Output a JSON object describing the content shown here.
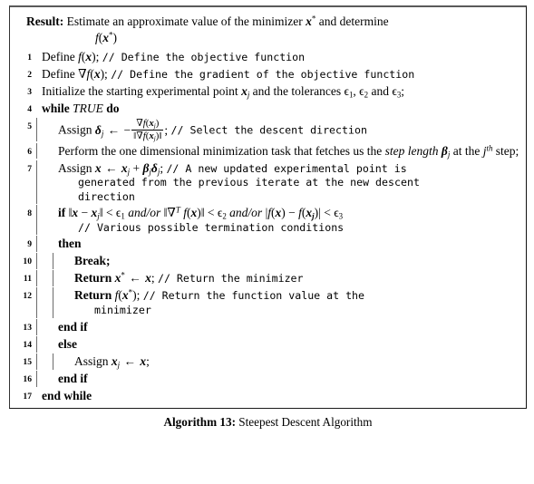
{
  "figure": {
    "caption_label": "Algorithm 13:",
    "caption_title": "Steepest Descent Algorithm"
  },
  "result": {
    "label": "Result:",
    "text": "Estimate an approximate value of the minimizer",
    "var_x_star": "x*",
    "text_tail": "and determine",
    "line2": "f(x*)"
  },
  "lines": [
    {
      "no": "1",
      "code": "Define f(x);",
      "comment": "// Define the objective function"
    },
    {
      "no": "2",
      "code": "Define ∇f(x);",
      "comment": "// Define the gradient of the objective function"
    },
    {
      "no": "3",
      "code": "Initialize the starting experimental point x_j and the tolerances ε1, ε2 and ε3;",
      "comment": ""
    },
    {
      "no": "4",
      "keyword": "while",
      "cond": "TRUE",
      "keyword2": "do",
      "code": "while TRUE do",
      "comment": ""
    },
    {
      "no": "5",
      "code": "Assign δ_j ← − ∇f(x_j) / ‖∇f(x_j)‖;",
      "comment": "// Select the descent direction"
    },
    {
      "no": "6",
      "code": "Perform the one dimensional minimization task that fetches us the step length β_j at the j-th step;",
      "text_a": "Perform the one dimensional minimization task that fetches us the",
      "em_a": "step",
      "em_b": "length",
      "text_b": "at the",
      "text_c": "step;",
      "comment": ""
    },
    {
      "no": "7",
      "code": "Assign x ← x_j + β_j δ_j;",
      "comment": "// A new updated experimental point is generated from the previous iterate at the new descent direction"
    },
    {
      "no": "8",
      "keyword": "if",
      "code": "if ‖x − x_j‖ < ε1 and/or ‖∇^T f(x)‖ < ε2 and/or |f(x) − f(x_j)| < ε3",
      "conj": "and/or",
      "comment": "// Various possible termination conditions"
    },
    {
      "no": "9",
      "keyword": "then",
      "code": "then",
      "comment": ""
    },
    {
      "no": "10",
      "keyword": "Break",
      "code": "Break;",
      "comment": ""
    },
    {
      "no": "11",
      "keyword": "Return",
      "code": "Return x* ← x;",
      "comment": "// Return the minimizer"
    },
    {
      "no": "12",
      "keyword": "Return",
      "code": "Return f(x*);",
      "comment": "// Return the function value at the minimizer"
    },
    {
      "no": "13",
      "keyword": "end if",
      "code": "end if",
      "comment": ""
    },
    {
      "no": "14",
      "keyword": "else",
      "code": "else",
      "comment": ""
    },
    {
      "no": "15",
      "code": "Assign x_j ← x;",
      "comment": ""
    },
    {
      "no": "16",
      "keyword": "end if",
      "code": "end if",
      "comment": ""
    },
    {
      "no": "17",
      "keyword": "end while",
      "code": "end while",
      "comment": ""
    }
  ],
  "symbols": {
    "arrow_left": "←",
    "minus": "−",
    "nabla": "∇",
    "delta": "δ",
    "beta": "β",
    "epsilon": "ϵ",
    "norm": "‖",
    "abs": "|",
    "lt": "<",
    "star": "*",
    "plus": "+"
  },
  "comments": {
    "c1": "// Define the objective function",
    "c2": "// Define the gradient of the objective function",
    "c5": "// Select the descent direction",
    "c7a": "// A new updated experimental point is",
    "c7b": "generated from the previous iterate at the new descent",
    "c7c": "direction",
    "c8": "// Various possible termination conditions",
    "c11": "// Return the minimizer",
    "c12a": "// Return the function value at the",
    "c12b": "minimizer"
  },
  "words": {
    "define": "Define",
    "initialize_a": "Initialize the starting experimental point",
    "initialize_b": "and the tolerances",
    "initialize_c": "and",
    "assign": "Assign",
    "perform_a": "Perform the one dimensional minimization task that fetches us the",
    "step": "step",
    "length": "length",
    "at_the": "at the",
    "step_semi": "step;",
    "while": "while",
    "true": "TRUE",
    "do": "do",
    "if": "if",
    "then": "then",
    "break": "Break;",
    "return": "Return",
    "else": "else",
    "end_if": "end if",
    "end_while": "end while",
    "and_or": "and/or"
  }
}
